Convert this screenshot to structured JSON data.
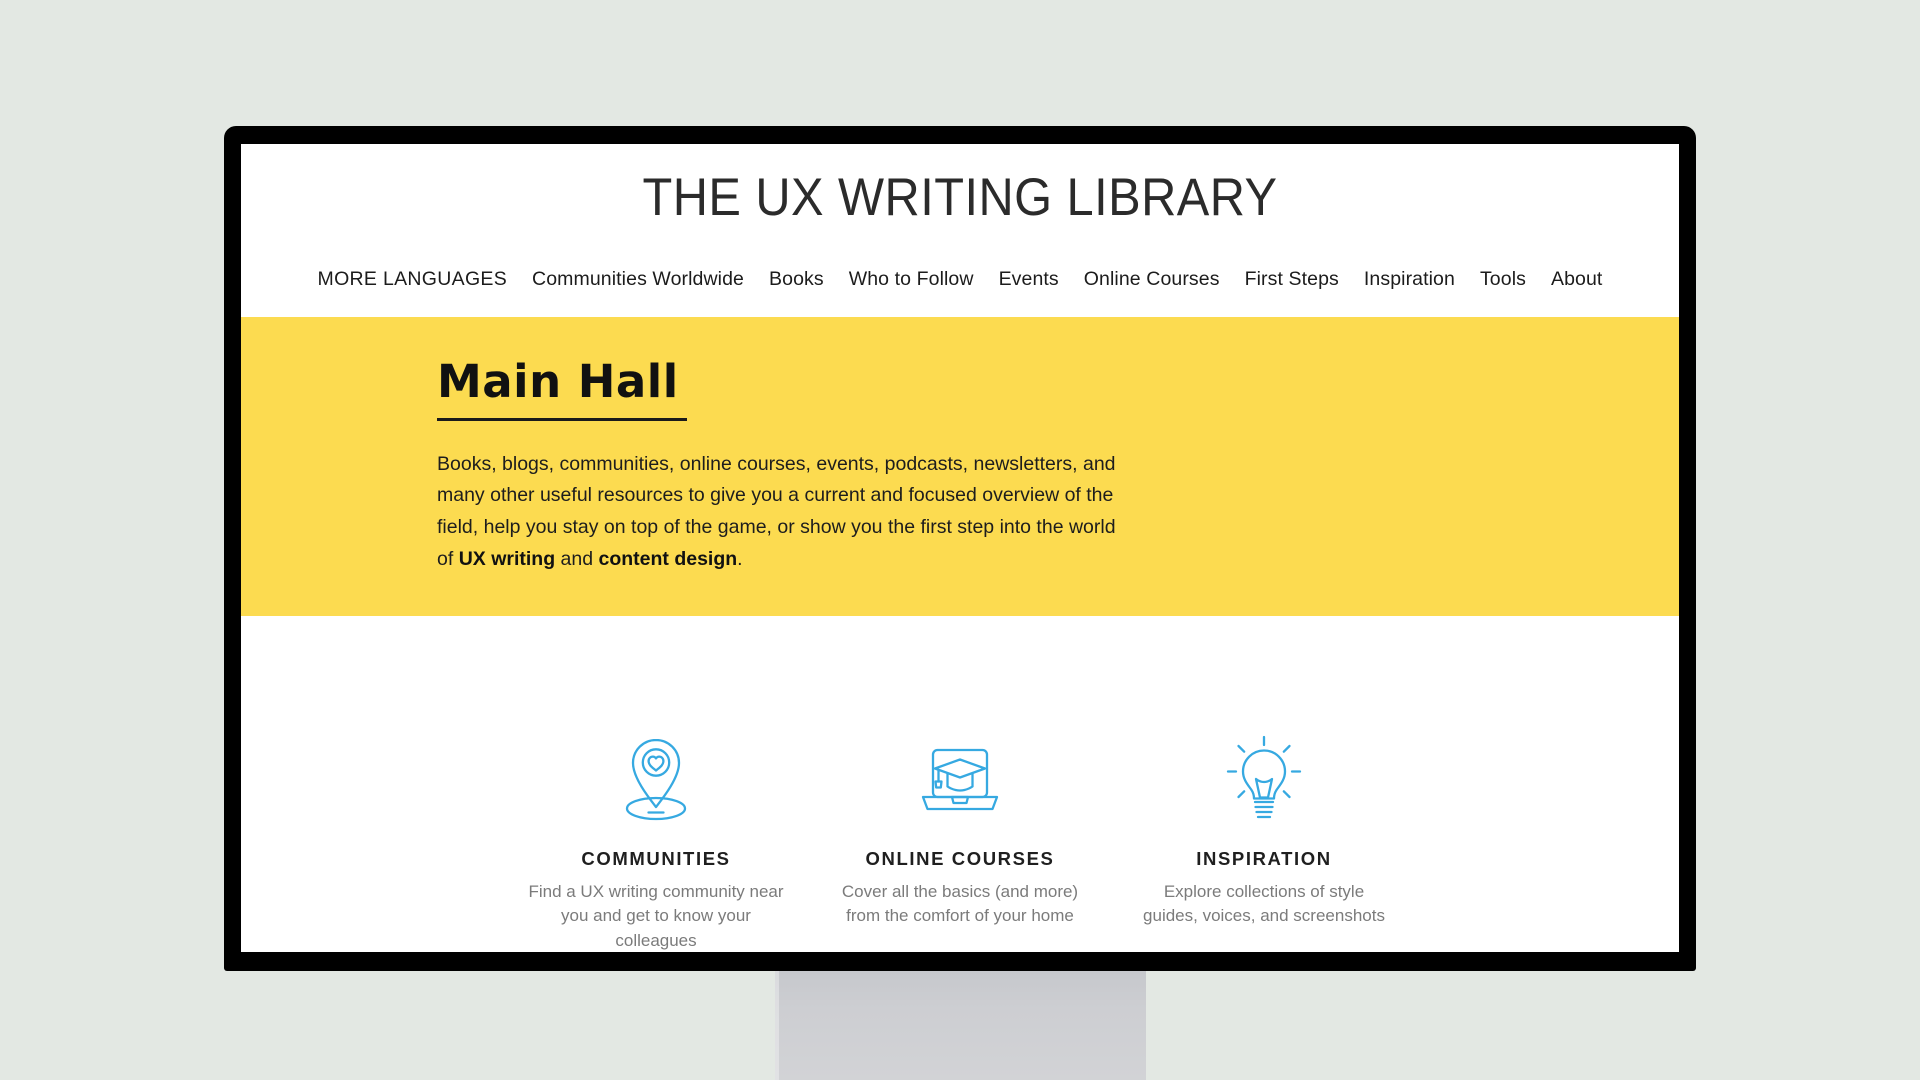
{
  "site": {
    "title": "THE UX WRITING LIBRARY"
  },
  "nav": {
    "items": [
      {
        "label": "MORE LANGUAGES",
        "caps": true
      },
      {
        "label": "Communities Worldwide",
        "caps": false
      },
      {
        "label": "Books",
        "caps": false
      },
      {
        "label": "Who to Follow",
        "caps": false
      },
      {
        "label": "Events",
        "caps": false
      },
      {
        "label": "Online Courses",
        "caps": false
      },
      {
        "label": "First Steps",
        "caps": false
      },
      {
        "label": "Inspiration",
        "caps": false
      },
      {
        "label": "Tools",
        "caps": false
      },
      {
        "label": "About",
        "caps": false
      }
    ]
  },
  "hero": {
    "title": "Main Hall",
    "paragraph_part1": "Books, blogs, communities, online courses, events, podcasts, newsletters, and many other useful resources to give you a current and focused overview of the field, help you stay on top of the game, or show you the first step into the world of ",
    "link1": "UX writing",
    "paragraph_part2": " and ",
    "link2": "content design",
    "paragraph_part3": ".",
    "background_color": "#fcdb50"
  },
  "features": {
    "accent_color": "#36a9e1",
    "cards": [
      {
        "icon": "map-pin-heart-icon",
        "title": "COMMUNITIES",
        "description": "Find a UX writing community near you and get to know your colleagues"
      },
      {
        "icon": "laptop-graduation-cap-icon",
        "title": "ONLINE COURSES",
        "description": "Cover all the basics (and more) from the comfort of your home"
      },
      {
        "icon": "lightbulb-icon",
        "title": "INSPIRATION",
        "description": "Explore collections of style guides, voices, and screenshots"
      }
    ]
  },
  "device": {
    "type": "desktop-monitor-mockup",
    "bezel_color": "#000000",
    "page_background": "#e3e8e3"
  }
}
